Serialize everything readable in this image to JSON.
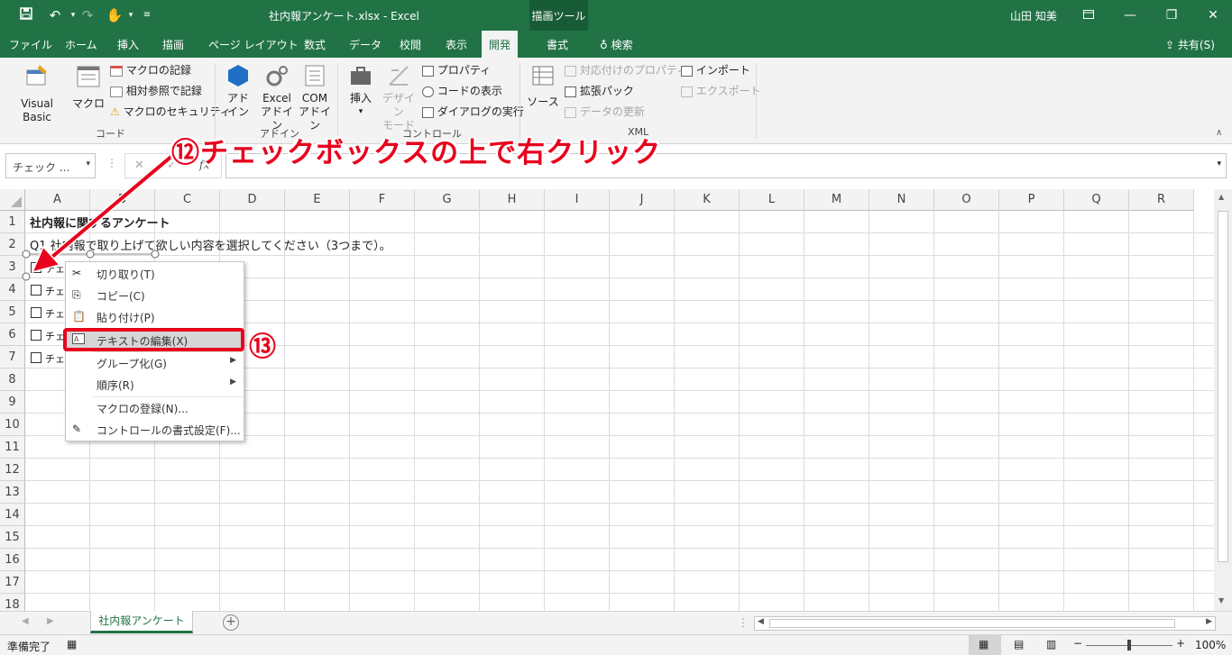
{
  "title": {
    "doc": "社内報アンケート.xlsx  -  Excel",
    "context_tab": "描画ツール",
    "user": "山田 知美"
  },
  "tabs": [
    "ファイル",
    "ホーム",
    "挿入",
    "描画",
    "ページ レイアウト",
    "数式",
    "データ",
    "校閲",
    "表示",
    "開発",
    "書式"
  ],
  "tellme": "検索",
  "share": "共有(S)",
  "ribbon": {
    "code": {
      "vb": "Visual Basic",
      "macro": "マクロ",
      "rec": "マクロの記録",
      "rel": "相対参照で記録",
      "sec": "マクロのセキュリティ",
      "label": "コード"
    },
    "addin": {
      "addin_l1": "アド",
      "addin_l2": "イン",
      "excel_l1": "Excel",
      "excel_l2": "アドイン",
      "com_l1": "COM",
      "com_l2": "アドイン",
      "label": "アドイン"
    },
    "controls": {
      "insert": "挿入",
      "design_l1": "デザイン",
      "design_l2": "モード",
      "props": "プロパティ",
      "viewcode": "コードの表示",
      "dialog": "ダイアログの実行",
      "label": "コントロール"
    },
    "xml": {
      "source": "ソース",
      "mapprops": "対応付けのプロパティ",
      "ext": "拡張パック",
      "refresh": "データの更新",
      "import": "インポート",
      "export": "エクスポート",
      "label": "XML"
    }
  },
  "namebox": "チェック ...",
  "columns": [
    "A",
    "B",
    "C",
    "D",
    "E",
    "F",
    "G",
    "H",
    "I",
    "J",
    "K",
    "L",
    "M",
    "N",
    "O",
    "P",
    "Q",
    "R"
  ],
  "rows": [
    "1",
    "2",
    "3",
    "4",
    "5",
    "6",
    "7",
    "8",
    "9",
    "10",
    "11",
    "12",
    "13",
    "14",
    "15",
    "16",
    "17",
    "18"
  ],
  "cells": {
    "a1": "社内報に関するアンケート",
    "a2": "Q1 社内報で取り上げて欲しい内容を選択してください（3つまで）。"
  },
  "checkbox_label": "チェッ",
  "context_menu": {
    "cut": "切り取り(T)",
    "copy": "コピー(C)",
    "paste": "貼り付け(P)",
    "edit": "テキストの編集(X)",
    "group": "グループ化(G)",
    "order": "順序(R)",
    "assign": "マクロの登録(N)...",
    "format": "コントロールの書式設定(F)..."
  },
  "annotations": {
    "step12": "⑫チェックボックスの上で右クリック",
    "step13": "⑬"
  },
  "sheet_tab": "社内報アンケート",
  "status": {
    "ready": "準備完了",
    "zoom": "100%"
  },
  "colors": {
    "excel_green": "#217346",
    "highlight": "#e8001c"
  }
}
